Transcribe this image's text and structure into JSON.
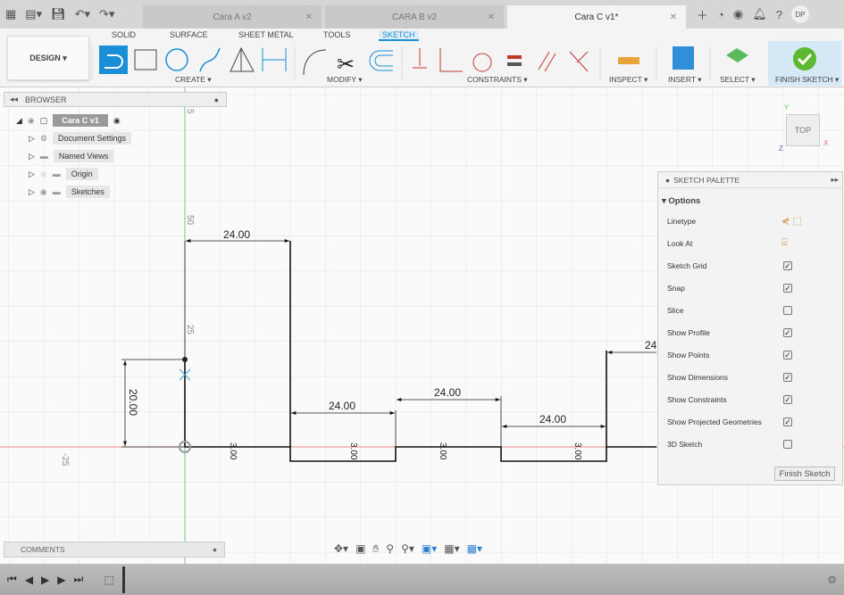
{
  "tabs": [
    {
      "label": "Cara A v2",
      "active": false
    },
    {
      "label": "CARA B v2",
      "active": false
    },
    {
      "label": "Cara C v1*",
      "active": true
    }
  ],
  "user_initials": "DP",
  "ribbon": {
    "workspace": "DESIGN ▾",
    "tabs": [
      "SOLID",
      "SURFACE",
      "SHEET METAL",
      "TOOLS",
      "SKETCH"
    ],
    "active_tab": "SKETCH",
    "groups": [
      "CREATE ▾",
      "MODIFY ▾",
      "CONSTRAINTS ▾",
      "INSPECT ▾",
      "INSERT ▾",
      "SELECT ▾",
      "FINISH SKETCH ▾"
    ]
  },
  "browser": {
    "title": "BROWSER",
    "root": "Cara C v1",
    "items": [
      "Document Settings",
      "Named Views",
      "Origin",
      "Sketches"
    ]
  },
  "palette": {
    "title": "SKETCH PALETTE",
    "section": "Options",
    "rows": [
      {
        "label": "Linetype",
        "type": "icons"
      },
      {
        "label": "Look At",
        "type": "icon"
      },
      {
        "label": "Sketch Grid",
        "checked": true
      },
      {
        "label": "Snap",
        "checked": true
      },
      {
        "label": "Slice",
        "checked": false
      },
      {
        "label": "Show Profile",
        "checked": true
      },
      {
        "label": "Show Points",
        "checked": true
      },
      {
        "label": "Show Dimensions",
        "checked": true
      },
      {
        "label": "Show Constraints",
        "checked": true
      },
      {
        "label": "Show Projected Geometries",
        "checked": true
      },
      {
        "label": "3D Sketch",
        "checked": false
      }
    ],
    "finish_button": "Finish Sketch"
  },
  "viewcube": {
    "face": "TOP",
    "axes": [
      "Y",
      "X",
      "Z"
    ]
  },
  "canvas": {
    "axis_labels": [
      "5",
      "50",
      "25",
      "-25"
    ],
    "dimensions": {
      "width1": "24.00",
      "width2": "24.00",
      "width3": "24.00",
      "width4": "24.00",
      "width5": "24",
      "height": "20.00",
      "depth1": "3.00",
      "depth2": "3.00",
      "depth3": "3.00",
      "depth4": "3.00"
    }
  },
  "comments": {
    "title": "COMMENTS"
  },
  "colors": {
    "accent": "#1a8fd8",
    "finish_green": "#5cb82e",
    "x_axis": "#e05050",
    "y_axis": "#6cc06c"
  }
}
